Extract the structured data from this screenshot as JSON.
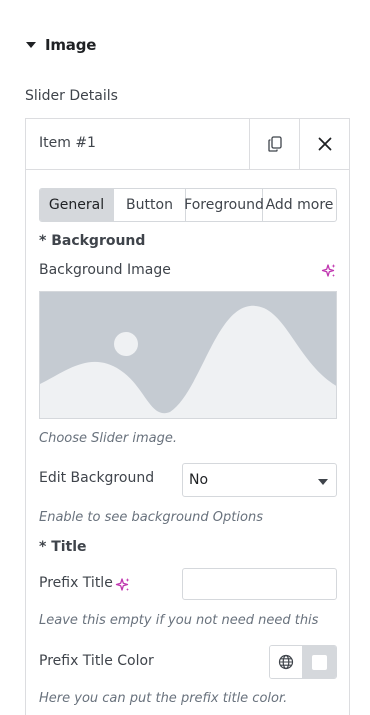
{
  "section": {
    "title": "Image",
    "toggle_icon": "caret-down-icon"
  },
  "slider_details_label": "Slider Details",
  "item": {
    "title": "Item #1",
    "duplicate_icon": "copy-icon",
    "remove_icon": "close-icon"
  },
  "tabs": [
    {
      "label": "General",
      "active": true
    },
    {
      "label": "Button",
      "active": false
    },
    {
      "label": "Foreground",
      "active": false
    },
    {
      "label": "Add more",
      "active": false
    }
  ],
  "background": {
    "heading": "* Background",
    "image_label": "Background Image",
    "ai_icon": "sparkle-ai-icon",
    "image_help": "Choose Slider image."
  },
  "edit_background": {
    "label": "Edit Background",
    "selected": "No",
    "help": "Enable to see background Options"
  },
  "title_section": {
    "heading": "* Title"
  },
  "prefix_title": {
    "label": "Prefix Title",
    "ai_icon": "sparkle-ai-icon",
    "value": "",
    "placeholder": "",
    "help": "Leave this empty if you not need need this"
  },
  "prefix_title_color": {
    "label": "Prefix Title Color",
    "global_icon": "globe-icon",
    "help": "Here you can put the prefix title color."
  },
  "colors": {
    "accent_ai": "#c036b0",
    "tab_active_bg": "#d5d8dc",
    "placeholder_bg": "#c5cbd2",
    "placeholder_fg": "#eff1f3"
  }
}
